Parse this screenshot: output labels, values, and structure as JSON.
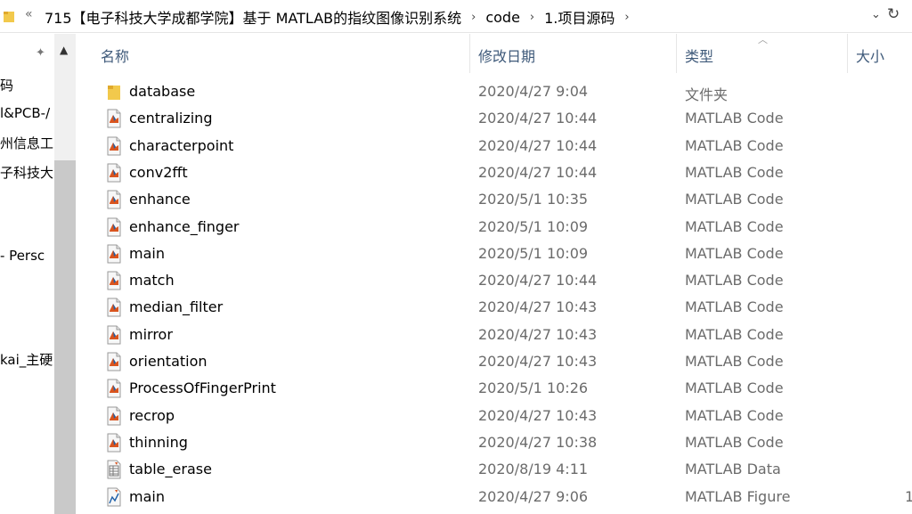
{
  "address_bar": {
    "overflow_glyph": "«",
    "breadcrumbs": [
      "715【电子科技大学成都学院】基于 MATLAB的指纹图像识别系统",
      "code",
      "1.项目源码"
    ],
    "separator": "›",
    "dropdown_glyph": "⌄",
    "refresh_glyph": "↻"
  },
  "nav_pane": {
    "items": [
      "码",
      "l&PCB-/",
      "州信息工",
      "子科技大",
      "- Persc",
      "kai_主硬"
    ]
  },
  "columns": {
    "name": "名称",
    "date": "修改日期",
    "type": "类型",
    "size": "大小"
  },
  "files": [
    {
      "name": "database",
      "date": "2020/4/27 9:04",
      "type": "文件夹",
      "size": "",
      "icon": "folder-icon"
    },
    {
      "name": "centralizing",
      "date": "2020/4/27 10:44",
      "type": "MATLAB Code",
      "size": "",
      "icon": "matlab-code-icon"
    },
    {
      "name": "characterpoint",
      "date": "2020/4/27 10:44",
      "type": "MATLAB Code",
      "size": "",
      "icon": "matlab-code-icon"
    },
    {
      "name": "conv2fft",
      "date": "2020/4/27 10:44",
      "type": "MATLAB Code",
      "size": "",
      "icon": "matlab-code-icon"
    },
    {
      "name": "enhance",
      "date": "2020/5/1 10:35",
      "type": "MATLAB Code",
      "size": "",
      "icon": "matlab-code-icon"
    },
    {
      "name": "enhance_finger",
      "date": "2020/5/1 10:09",
      "type": "MATLAB Code",
      "size": "",
      "icon": "matlab-code-icon"
    },
    {
      "name": "main",
      "date": "2020/5/1 10:09",
      "type": "MATLAB Code",
      "size": "",
      "icon": "matlab-code-icon"
    },
    {
      "name": "match",
      "date": "2020/4/27 10:44",
      "type": "MATLAB Code",
      "size": "",
      "icon": "matlab-code-icon"
    },
    {
      "name": "median_filter",
      "date": "2020/4/27 10:43",
      "type": "MATLAB Code",
      "size": "",
      "icon": "matlab-code-icon"
    },
    {
      "name": "mirror",
      "date": "2020/4/27 10:43",
      "type": "MATLAB Code",
      "size": "",
      "icon": "matlab-code-icon"
    },
    {
      "name": "orientation",
      "date": "2020/4/27 10:43",
      "type": "MATLAB Code",
      "size": "",
      "icon": "matlab-code-icon"
    },
    {
      "name": "ProcessOfFingerPrint",
      "date": "2020/5/1 10:26",
      "type": "MATLAB Code",
      "size": "",
      "icon": "matlab-code-icon"
    },
    {
      "name": "recrop",
      "date": "2020/4/27 10:43",
      "type": "MATLAB Code",
      "size": "",
      "icon": "matlab-code-icon"
    },
    {
      "name": "thinning",
      "date": "2020/4/27 10:38",
      "type": "MATLAB Code",
      "size": "",
      "icon": "matlab-code-icon"
    },
    {
      "name": "table_erase",
      "date": "2020/8/19 4:11",
      "type": "MATLAB Data",
      "size": "",
      "icon": "matlab-data-icon"
    },
    {
      "name": "main",
      "date": "2020/4/27 9:06",
      "type": "MATLAB Figure",
      "size": "1",
      "icon": "matlab-figure-icon"
    }
  ],
  "colors": {
    "header_text": "#3f5a7a",
    "secondary_text": "#6b6b6b",
    "folder": "#e8b84b",
    "matlab_orange": "#d9541e"
  }
}
